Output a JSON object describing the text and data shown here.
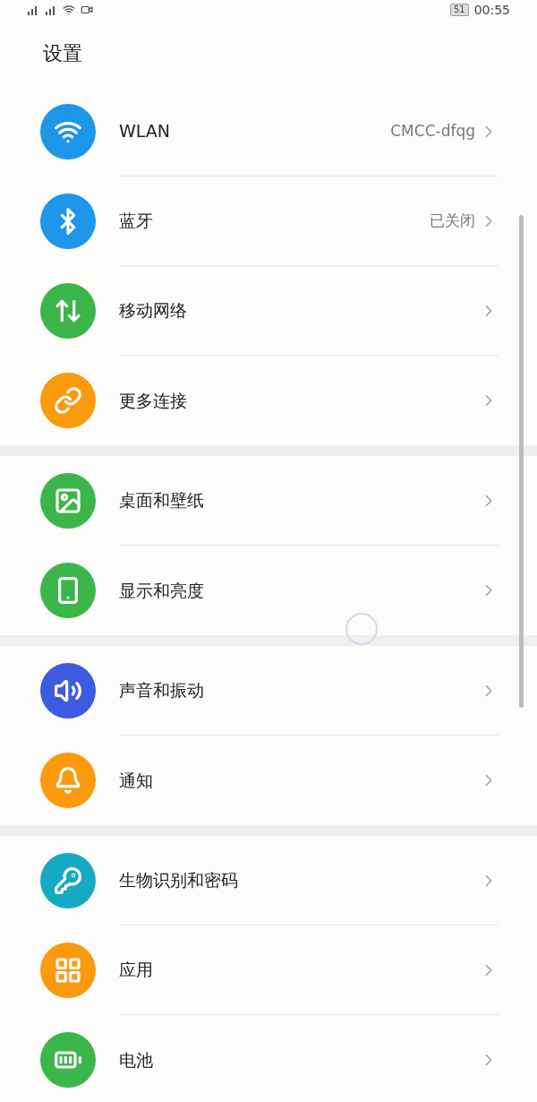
{
  "status_bar": {
    "battery": "51",
    "time": "00:55"
  },
  "title": "设置",
  "groups": [
    {
      "items": [
        {
          "label": "WLAN",
          "value": "CMCC-dfqg",
          "color": "#1e96ea"
        },
        {
          "label": "蓝牙",
          "value": "已关闭",
          "color": "#1e96ea"
        },
        {
          "label": "移动网络",
          "color": "#3cb54a"
        },
        {
          "label": "更多连接",
          "color": "#fb9a0e"
        }
      ]
    },
    {
      "items": [
        {
          "label": "桌面和壁纸",
          "color": "#3cb54a"
        },
        {
          "label": "显示和亮度",
          "color": "#3cb54a"
        }
      ]
    },
    {
      "items": [
        {
          "label": "声音和振动",
          "color": "#3d5ae0"
        },
        {
          "label": "通知",
          "color": "#fb9a0e"
        }
      ]
    },
    {
      "items": [
        {
          "label": "生物识别和密码",
          "color": "#16a9c4"
        },
        {
          "label": "应用",
          "color": "#fb9a0e"
        },
        {
          "label": "电池",
          "color": "#3cb54a"
        }
      ]
    }
  ]
}
